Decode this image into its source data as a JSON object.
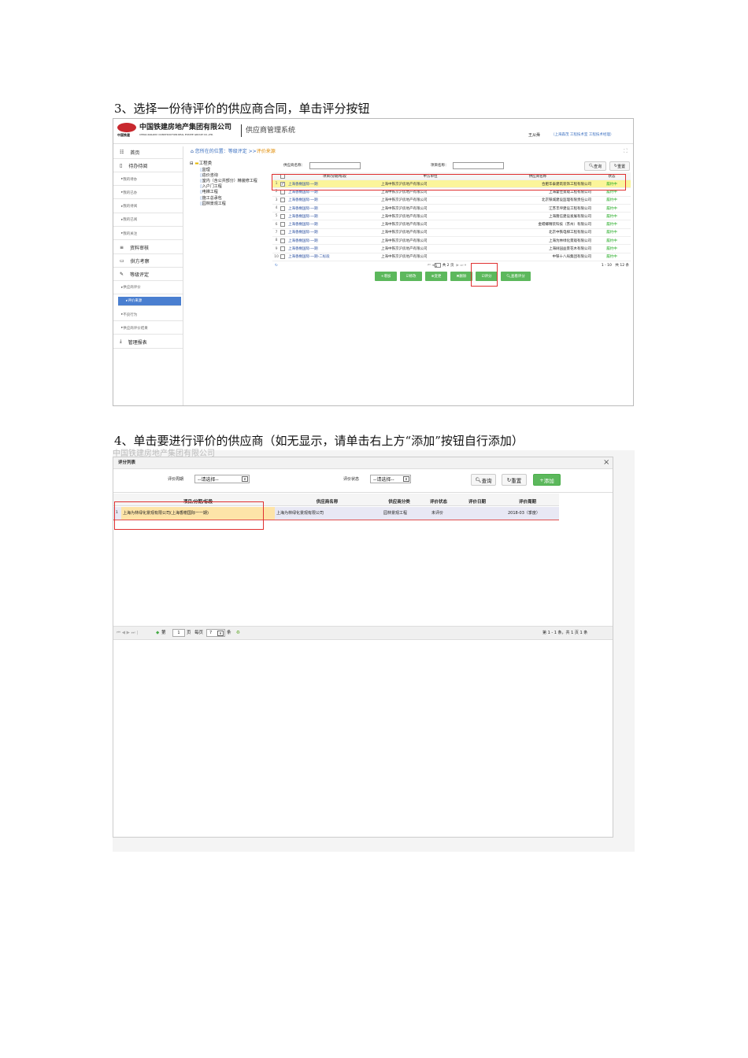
{
  "step3": "3、选择一份待评价的供应商合同，单击评分按钮",
  "step4": "4、单击要进行评价的供应商（如无显示，请单击右上方“添加”按钮自行添加）",
  "app": {
    "company": "中国铁建房地产集团有限公司",
    "company_en": "CHINA RAILWAY CONSTRUCTION REAL ESTATE GROUP CO.,LTD.",
    "logo_text": "中国铁建",
    "system": "供应商管理系统",
    "user": "王从舜",
    "user_org": "（上海森茂 工程技术室 工程技术经理）"
  },
  "sidebar": [
    {
      "label": "首页",
      "icon": "grid-icon"
    },
    {
      "label": "待办待阅",
      "icon": "clipboard-icon"
    },
    {
      "label": "我的待办",
      "sub": true
    },
    {
      "label": "我的已办",
      "sub": true
    },
    {
      "label": "我的待阅",
      "sub": true
    },
    {
      "label": "我的已阅",
      "sub": true
    },
    {
      "label": "我的关注",
      "sub": true
    },
    {
      "label": "资料审核",
      "icon": "list-icon"
    },
    {
      "label": "供方考察",
      "icon": "card-icon"
    },
    {
      "label": "等级评定",
      "icon": "pencil-icon"
    },
    {
      "label": "供应商评价",
      "sub": true
    },
    {
      "label": "评价来源",
      "sub": true,
      "active": true
    },
    {
      "label": "不良行为",
      "sub": true
    },
    {
      "label": "供应商评价结果",
      "sub": true
    },
    {
      "label": "管理报表",
      "icon": "download-icon"
    }
  ],
  "breadcrumb": {
    "prefix": "您所在的位置：等级评定 >>",
    "current": "评价来源"
  },
  "tree": {
    "root": "工程类",
    "children": [
      "监理",
      "造价咨询",
      "室内（含公共部分）精装修工程",
      "入户门工程",
      "电梯工程",
      "施工总承包",
      "园林景观工程"
    ]
  },
  "filters": {
    "supplier_label": "供应商名称：",
    "project_label": "项目名称：",
    "search": "查询",
    "reset": "重置"
  },
  "grid": {
    "headers": [
      "项目/分期/标段",
      "甲方单位",
      "供应商名称",
      "状态"
    ],
    "rows": [
      [
        "上海香榭国际-一期",
        "上海中铁京沪房地产有限公司",
        "合肥华泰建筑装饰工程有限公司",
        "履约中"
      ],
      [
        "上海香榭国际-一期",
        "上海中铁京沪房地产有限公司",
        "上海霍佳景观工程有限公司",
        "履约中"
      ],
      [
        "上海香榭国际-一期",
        "上海中铁京沪房地产有限公司",
        "北京铁城建设监理有限责任公司",
        "履约中"
      ],
      [
        "上海香榭国际-一期",
        "上海中铁京沪房地产有限公司",
        "江苏丰坪建设工程有限公司",
        "履约中"
      ],
      [
        "上海香榭国际-一期",
        "上海中铁京沪房地产有限公司",
        "上海隆信建设发展有限公司",
        "履约中"
      ],
      [
        "上海香榭国际-一期",
        "上海中铁京沪房地产有限公司",
        "金螳螂精装科技（苏州）有限公司",
        "履约中"
      ],
      [
        "上海香榭国际-一期",
        "上海中铁京沪房地产有限公司",
        "北京中铁电梯工程有限公司",
        "履约中"
      ],
      [
        "上海香榭国际-一期",
        "上海中铁京沪房地产有限公司",
        "上海为林绿化景观有限公司",
        "履约中"
      ],
      [
        "上海香榭国际-一期",
        "上海中铁京沪房地产有限公司",
        "上海树园益景花木有限公司",
        "履约中"
      ],
      [
        "上海香榭国际-一期-二标段",
        "上海中铁京沪房地产有限公司",
        "中铁十八局集团有限公司",
        "履约中"
      ]
    ],
    "pager": {
      "page": "1",
      "total_pages": "共 2 页",
      "range": "1 - 10　共 12 条"
    }
  },
  "buttons": [
    "增加",
    "修改",
    "变更",
    "删除",
    "评分",
    "查看评分"
  ],
  "dialog": {
    "title": "评分列表",
    "period_label": "评价周期",
    "period_value": "--请选择--",
    "status_label": "评价状态",
    "status_value": "--请选择--",
    "search": "查询",
    "reset": "重置",
    "add": "添加",
    "headers": [
      "项目/分期/标段",
      "供应商名称",
      "供应商分类",
      "评价状态",
      "评价日期",
      "评价周期"
    ],
    "row": {
      "no": "1",
      "project": "上海为林绿化景观有限公司(上海香榭国际一一期)",
      "supplier": "上海为林绿化景观有限公司",
      "category": "园林景观工程",
      "status": "未评价",
      "date": "",
      "period": "2018-03（季度）"
    },
    "pager": {
      "first": "第",
      "page": "1",
      "page_suffix": "页",
      "per_page_label": "每页",
      "per_page": "7",
      "per_suffix": "条",
      "summary": "第 1 - 1 条，共 1 页 1 条"
    }
  },
  "colors": {
    "green": "#5cb85c",
    "red": "#e03030",
    "blue": "#4a7fd0",
    "status": "#22aa22"
  }
}
